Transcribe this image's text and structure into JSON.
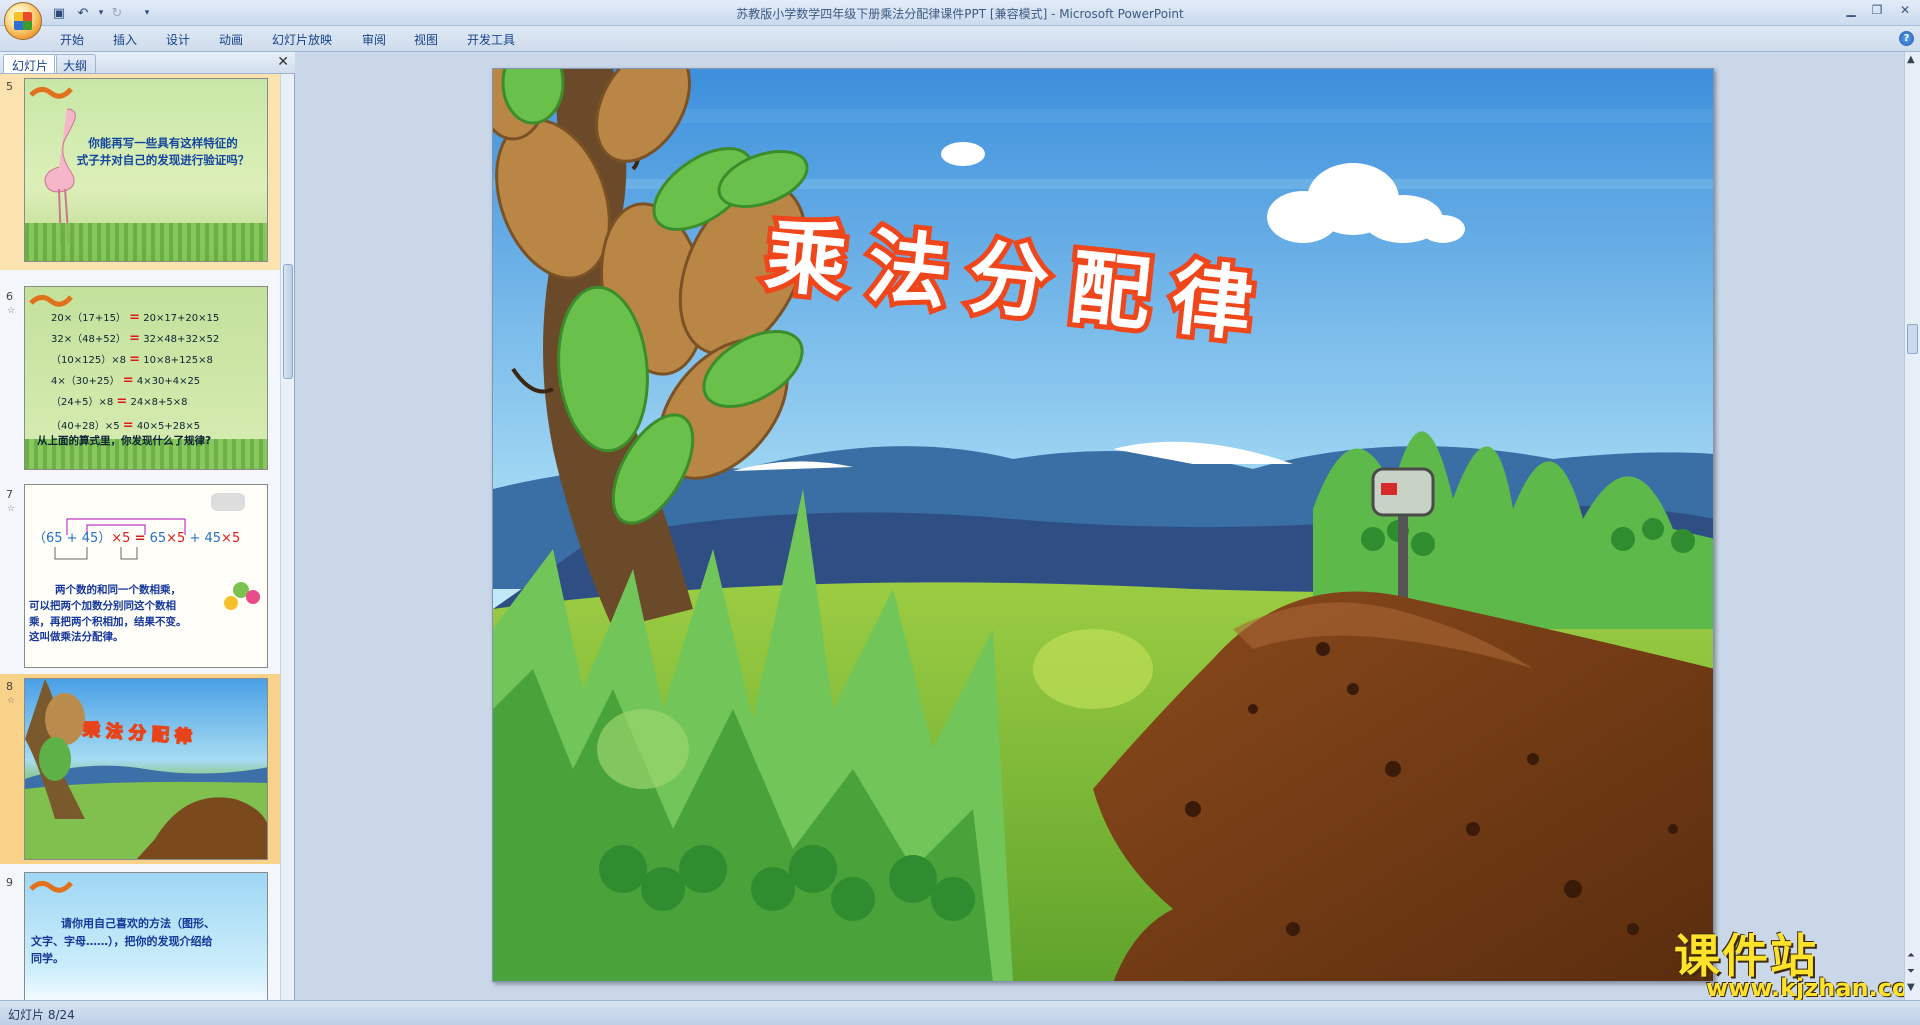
{
  "window": {
    "title": "苏教版小学数学四年级下册乘法分配律课件PPT [兼容模式] - Microsoft PowerPoint",
    "min_icon": "minimize-icon",
    "max_icon": "restore-icon",
    "close_icon": "close-icon"
  },
  "quick_access": [
    {
      "name": "save-icon",
      "glyph": "💾"
    },
    {
      "name": "undo-icon",
      "glyph": "↶"
    },
    {
      "name": "redo-icon",
      "glyph": "↻"
    }
  ],
  "ribbon_tabs": [
    "开始",
    "插入",
    "设计",
    "动画",
    "幻灯片放映",
    "审阅",
    "视图",
    "开发工具"
  ],
  "left_panel": {
    "tabs": [
      "幻灯片",
      "大纲"
    ],
    "slides": [
      {
        "number": "5",
        "lines": [
          "你能再写一些具有这样特征的",
          "式子并对自己的发现进行验证吗？"
        ]
      },
      {
        "number": "6",
        "equations": [
          {
            "left": "20×（17+15）",
            "right": "20×17+20×15"
          },
          {
            "left": "32×（48+52）",
            "right": "32×48+32×52"
          },
          {
            "left": "（10×125）×8",
            "right": "10×8+125×8"
          },
          {
            "left": "4×（30+25）",
            "right": "4×30+4×25"
          },
          {
            "left": "（24+5）×8",
            "right": "24×8+5×8"
          },
          {
            "left": "（40+28）×5",
            "right": "40×5+28×5"
          }
        ],
        "question": "从上面的算式里，你发现什么了规律?"
      },
      {
        "number": "7",
        "formula": {
          "left": "（65 + 45）",
          "times": "×5",
          "eq": "=",
          "a": "65",
          "b": "×5",
          "plus": "+ 45",
          "c": "×5"
        },
        "rule_lines": [
          "两个数的和同一个数相乘，",
          "可以把两个加数分别同这个数相",
          "乘，再把两个积相加，结果不变。",
          "这叫做乘法分配律。"
        ]
      },
      {
        "number": "8",
        "title": "乘法分配律"
      },
      {
        "number": "9",
        "lines": [
          "请你用自己喜欢的方法（图形、",
          "文字、字母……），把你的发现介绍给",
          "同学。"
        ]
      }
    ]
  },
  "slide": {
    "title": "乘法分配律"
  },
  "status": {
    "slide_indicator": "幻灯片 8/24"
  },
  "watermark": {
    "brand": "课件站",
    "url": "www.kjzhan.com"
  },
  "colors": {
    "title_fill": "#ffffff",
    "title_stroke": "#f0461b",
    "selection": "#f9d28a",
    "sky_top": "#3d8fdc",
    "sky_bottom": "#c7ecfa",
    "watermark": "#ffe22a"
  }
}
